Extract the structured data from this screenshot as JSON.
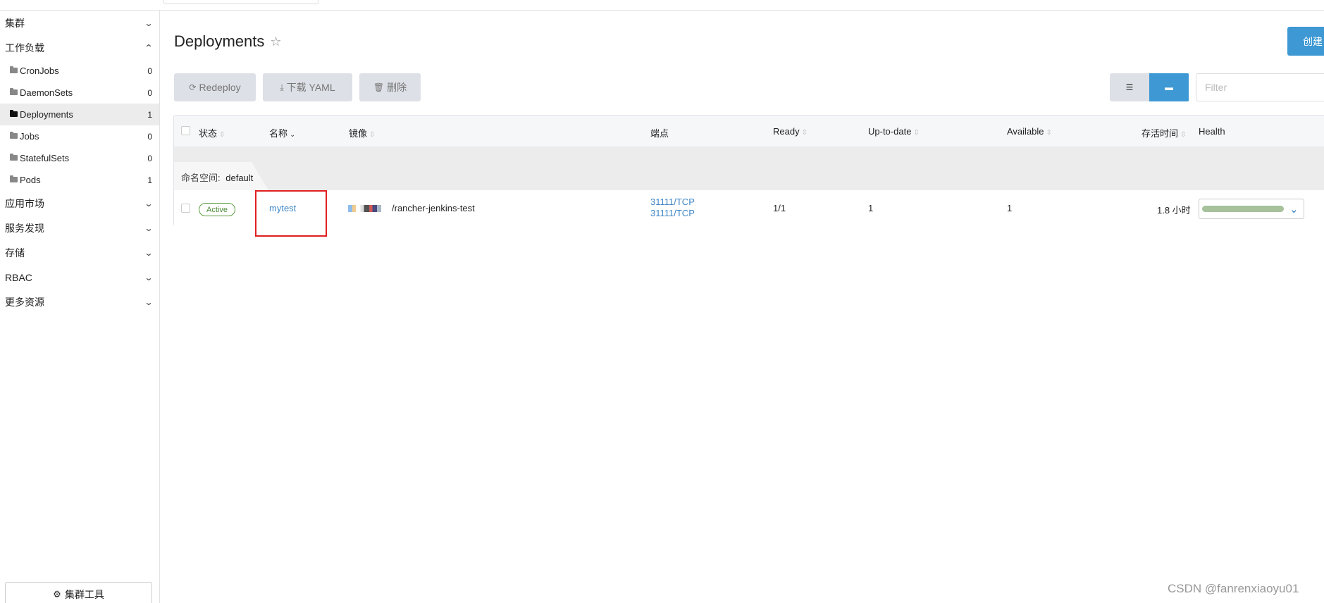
{
  "sidebar": {
    "groups_top": [
      {
        "label": "集群"
      },
      {
        "label": "工作负载"
      }
    ],
    "items": [
      {
        "label": "CronJobs",
        "count": "0"
      },
      {
        "label": "DaemonSets",
        "count": "0"
      },
      {
        "label": "Deployments",
        "count": "1"
      },
      {
        "label": "Jobs",
        "count": "0"
      },
      {
        "label": "StatefulSets",
        "count": "0"
      },
      {
        "label": "Pods",
        "count": "1"
      }
    ],
    "groups_bottom": [
      {
        "label": "应用市场"
      },
      {
        "label": "服务发现"
      },
      {
        "label": "存储"
      },
      {
        "label": "RBAC"
      },
      {
        "label": "更多资源"
      }
    ],
    "tools_label": "集群工具"
  },
  "header": {
    "title": "Deployments",
    "create_label": "创建"
  },
  "toolbar": {
    "redeploy_label": "Redeploy",
    "download_label": "下载 YAML",
    "delete_label": "删除",
    "filter_placeholder": "Filter"
  },
  "table": {
    "columns": [
      "状态",
      "名称",
      "镜像",
      "端点",
      "Ready",
      "Up-to-date",
      "Available",
      "存活时间",
      "Health"
    ],
    "namespace_label": "命名空间:",
    "namespace": "default",
    "rows": [
      {
        "status": "Active",
        "name": "mytest",
        "image": "/rancher-jenkins-test",
        "endpoint_1": "31111/TCP",
        "endpoint_2": "31111/TCP",
        "ready": "1/1",
        "up_to_date": "1",
        "available": "1",
        "age": "1.8 小时"
      }
    ]
  },
  "watermark": "CSDN @fanrenxiaoyu01",
  "colors": {
    "accent": "#3d98d3",
    "active_badge": "#4b8a35",
    "highlight": "#e02020"
  }
}
